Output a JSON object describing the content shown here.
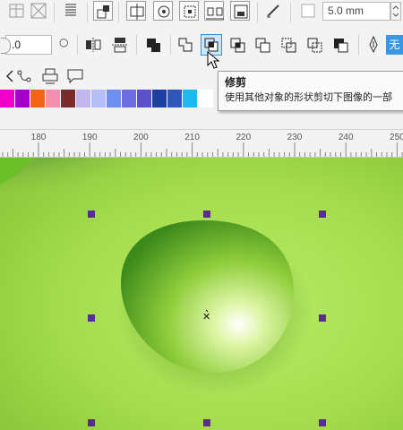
{
  "toolbar_top": {
    "size_value": "5.0 mm"
  },
  "toolbar_props": {
    "angle_value": ".0",
    "none_label": "无"
  },
  "palette": {
    "colors": [
      "#ee00c6",
      "#a300c8",
      "#f26418",
      "#f58fb0",
      "#7a2b2b",
      "#c1b6ee",
      "#b4bff7",
      "#6f8ff0",
      "#6d6de0",
      "#5b52c9",
      "#1c3fa1",
      "#2f57b8",
      "#1fb9f0",
      "#ffffff"
    ]
  },
  "tooltip": {
    "title": "修剪",
    "description": "使用其他对象的形状剪切下图像的一部"
  },
  "ruler": {
    "ticks": [
      "180",
      "190",
      "200",
      "210",
      "220",
      "230",
      "240",
      "250"
    ]
  },
  "colors": {
    "canvas_green": "#a6df4e",
    "handle_purple": "#5b2b94",
    "active_button": "#cfe6fb",
    "none_badge": "#3d96e3"
  }
}
